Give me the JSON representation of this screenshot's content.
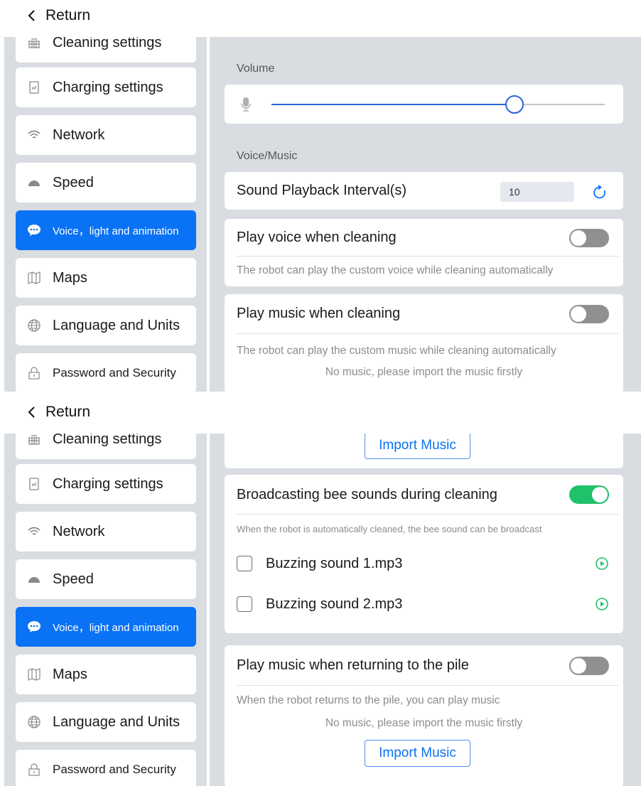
{
  "header": {
    "return_label": "Return"
  },
  "sidebar": {
    "items": [
      {
        "label": "Cleaning settings",
        "icon": "grid-icon"
      },
      {
        "label": "Charging settings",
        "icon": "battery-chart-icon"
      },
      {
        "label": "Network",
        "icon": "wifi-icon"
      },
      {
        "label": "Speed",
        "icon": "speed-gauge-icon"
      },
      {
        "label": "Voice，light and animation",
        "icon": "chat-bubble-icon",
        "active": true
      },
      {
        "label": "Maps",
        "icon": "map-icon"
      },
      {
        "label": "Language and Units",
        "icon": "globe-icon"
      },
      {
        "label": "Password and Security",
        "icon": "lock-icon"
      }
    ]
  },
  "volume": {
    "section_label": "Volume",
    "level": 0.73
  },
  "voice_music": {
    "section_label": "Voice/Music",
    "interval_label": "Sound Playback Interval(s)",
    "interval_value": "10"
  },
  "play_voice": {
    "title": "Play voice when cleaning",
    "hint": "The robot can play the custom voice while cleaning automatically",
    "enabled": false
  },
  "play_music": {
    "title": "Play music when cleaning",
    "hint": "The robot can play the custom music while cleaning automatically",
    "no_music": "No music, please import the music firstly",
    "import_label": "Import Music",
    "enabled": false
  },
  "bee_sounds": {
    "title": "Broadcasting bee sounds during cleaning",
    "hint": "When the robot is automatically cleaned, the bee sound can be broadcast",
    "enabled": true,
    "files": [
      {
        "name": "Buzzing sound 1.mp3",
        "checked": false
      },
      {
        "name": "Buzzing sound 2.mp3",
        "checked": false
      }
    ]
  },
  "return_music": {
    "title": "Play music when returning to the pile",
    "hint": "When the robot returns to the pile, you can play music",
    "no_music": "No music, please import the music firstly",
    "import_label": "Import Music",
    "enabled": false
  },
  "colors": {
    "accent": "#0a72f4",
    "toggle_on": "#1fc16b",
    "toggle_off": "#909090",
    "background": "#d9dde1"
  }
}
